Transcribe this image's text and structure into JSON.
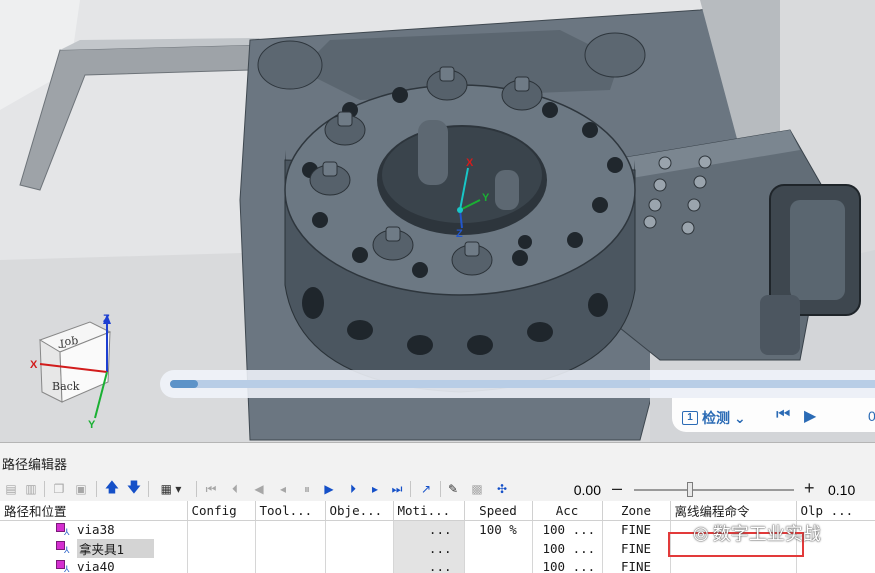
{
  "viewport": {
    "view_cube": {
      "top_label": "Top",
      "back_label": "Back"
    },
    "axes": {
      "x": "X",
      "y": "Y",
      "z": "Z"
    },
    "tool_frame_axes": {
      "x": "X",
      "y": "Y",
      "z": "Z"
    }
  },
  "video_overlay": {
    "progress": 0.04,
    "chapter_number": "1",
    "chapter_label": "检测",
    "time_prefix": "0"
  },
  "path_editor": {
    "title": "路径编辑器",
    "time_value": "0.00",
    "minus_label": "–",
    "plus_label": "+",
    "step_value": "0.10",
    "slider_position": 0.35,
    "columns": [
      "路径和位置",
      "Config",
      "Tool...",
      "Obje...",
      "Moti...",
      "Speed",
      "Acc",
      "Zone",
      "离线编程命令",
      "Olp ..."
    ],
    "rows": [
      {
        "name": "via38",
        "config": "",
        "tool": "",
        "object": "",
        "motion": "...",
        "speed": "100 %",
        "acc": "100 ...",
        "zone": "FINE",
        "olp_cmd": "",
        "olp": "",
        "selected": false
      },
      {
        "name": "拿夹具1",
        "config": "",
        "tool": "",
        "object": "",
        "motion": "...",
        "speed": "",
        "acc": "100 ...",
        "zone": "FINE",
        "olp_cmd": "",
        "olp": "",
        "selected": true
      },
      {
        "name": "via40",
        "config": "",
        "tool": "",
        "object": "",
        "motion": "...",
        "speed": "",
        "acc": "100 ...",
        "zone": "FINE",
        "olp_cmd": "",
        "olp": "",
        "selected": false
      }
    ]
  },
  "watermark": {
    "text": "数字工业实战"
  },
  "colors": {
    "viewport_bg": "#d9dadc",
    "part_dark": "#4f5a63",
    "part_face": "#6c7883",
    "highlight_red": "#e23a3a",
    "progress_blue": "#5d93c8",
    "link_blue": "#2b6bb5"
  }
}
